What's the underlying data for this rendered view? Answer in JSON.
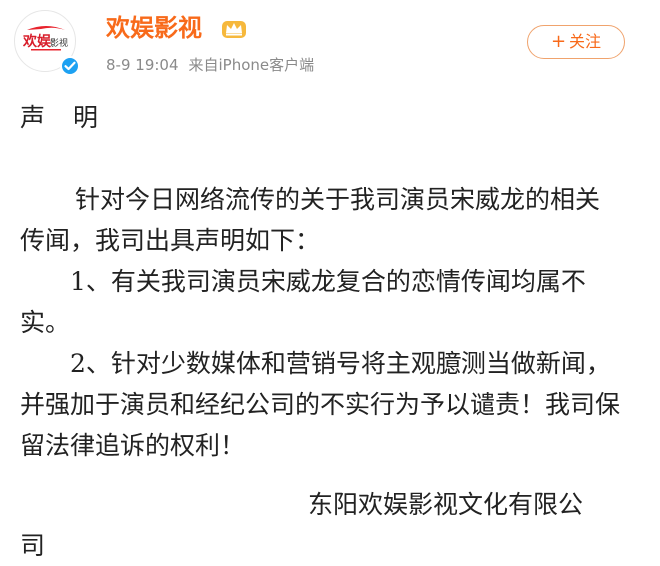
{
  "account": {
    "name": "欢娱影视",
    "avatar_text": "欢娱影视",
    "avatar_icon": "huanyu-logo",
    "verified_icon": "verified-badge-icon",
    "member_icon": "crown-icon"
  },
  "post_meta": {
    "date": "8-9",
    "time": "19:04",
    "source": "来自iPhone客户端"
  },
  "follow_button": {
    "plus": "+",
    "label": "关注"
  },
  "statement": {
    "title": "声明",
    "intro": "针对今日网络流传的关于我司演员宋威龙的相关传闻，我司出具声明如下：",
    "point_1": "1、有关我司演员宋威龙复合的恋情传闻均属不实。",
    "point_2": "2、针对少数媒体和营销号将主观臆测当做新闻，并强加于演员和经纪公司的不实行为予以谴责！我司保留法律追诉的权利！",
    "signature_line": "东阳欢娱影视文化有限公",
    "signature_wrap": "司"
  },
  "colors": {
    "brand_orange": "#f86a1a",
    "meta_gray": "#8a8a8a",
    "text": "#222222",
    "verified_blue": "#1da1f2",
    "avatar_red": "#e8232d"
  }
}
